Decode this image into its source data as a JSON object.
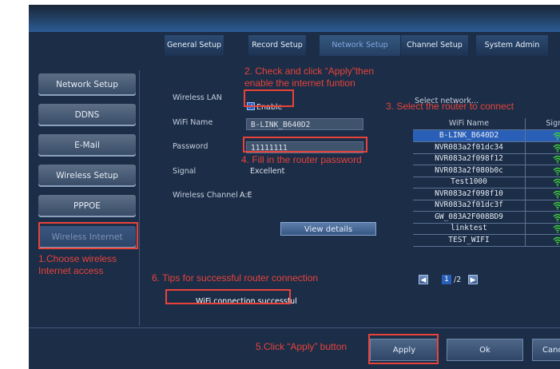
{
  "tabs": [
    "General Setup",
    "Record Setup",
    "Network Setup",
    "Channel Setup",
    "System Admin"
  ],
  "sidebar": [
    "Network Setup",
    "DDNS",
    "E-Mail",
    "Wireless Setup",
    "PPPOE",
    "Wireless Internet"
  ],
  "form": {
    "wireless_lan_label": "Wireless LAN",
    "enable_label": "Enable",
    "wifi_name_label": "WiFi Name",
    "wifi_name_value": "B-LINK_B640D2",
    "password_label": "Password",
    "password_value": "11111111",
    "signal_label": "Signal",
    "signal_value": "Excellent",
    "channel_label": "Wireless Channel",
    "channel_value": "A:E",
    "view_details": "View details"
  },
  "networks": {
    "title": "Select network...",
    "col_name": "WiFi Name",
    "col_signal": "Signal",
    "rows": [
      "B-LINK_B640D2",
      "NVR083a2f01dc34",
      "NVR083a2f098f12",
      "NVR083a2f080b0c",
      "Test1000",
      "NVR083a2f098f10",
      "NVR083a2f01dc3f",
      "GW_083A2F008BD9",
      "linktest",
      "TEST_WIFI"
    ],
    "selected_index": 0
  },
  "pagination": {
    "current": "1",
    "total": "/2"
  },
  "status_text": "WiFi connection successful",
  "buttons": {
    "apply": "Apply",
    "ok": "Ok",
    "cancel": "Cancel"
  },
  "annotations": {
    "a1_line1": "1.Choose wireless",
    "a1_line2": "Internet access",
    "a2_line1": "2. Check and click “Apply”then",
    "a2_line2": "enable the internet funtion",
    "a3": "3. Select the router to connect",
    "a4": "4. Fill in the router password",
    "a5": "5.Click “Apply” button",
    "a6": "6. Tips for successful router connection"
  },
  "colors": {
    "annotation": "#e8433a",
    "panel": "#1b2d47",
    "selection": "#2a5fb8",
    "wifi_signal": "#3fcf3a"
  }
}
